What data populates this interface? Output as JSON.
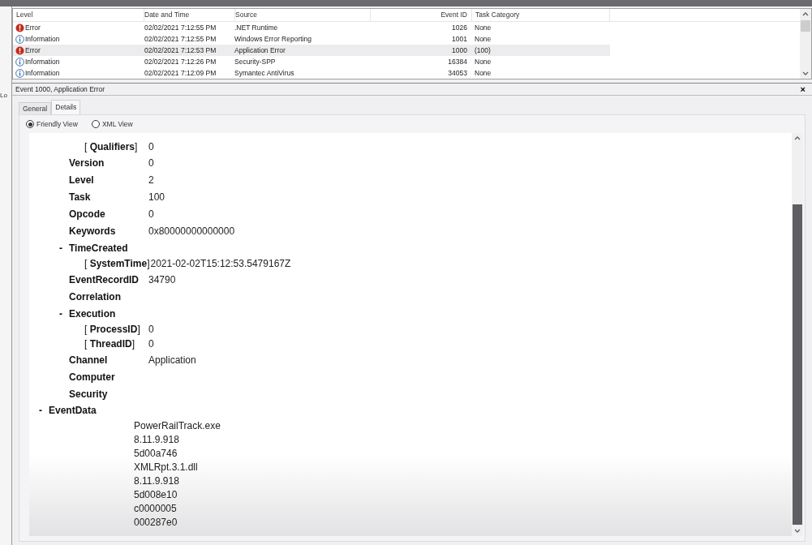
{
  "left_pane": {
    "text": "Lo"
  },
  "events": {
    "columns": [
      "Level",
      "Date and Time",
      "Source",
      "Event ID",
      "Task Category"
    ],
    "rows": [
      {
        "kind": "error",
        "level": "Error",
        "datetime": "02/02/2021 7:12:55 PM",
        "source": ".NET Runtime",
        "event_id": "1026",
        "task": "None",
        "selected": false
      },
      {
        "kind": "information",
        "level": "Information",
        "datetime": "02/02/2021 7:12:55 PM",
        "source": "Windows Error Reporting",
        "event_id": "1001",
        "task": "None",
        "selected": false
      },
      {
        "kind": "error",
        "level": "Error",
        "datetime": "02/02/2021 7:12:53 PM",
        "source": "Application Error",
        "event_id": "1000",
        "task": "(100)",
        "selected": true
      },
      {
        "kind": "information",
        "level": "Information",
        "datetime": "02/02/2021 7:12:26 PM",
        "source": "Security-SPP",
        "event_id": "16384",
        "task": "None",
        "selected": false
      },
      {
        "kind": "information",
        "level": "Information",
        "datetime": "02/02/2021 7:12:09 PM",
        "source": "Symantec AntiVirus",
        "event_id": "34053",
        "task": "None",
        "selected": false
      }
    ]
  },
  "details": {
    "title": "Event 1000, Application Error",
    "close": "×",
    "tabs": [
      {
        "label": "General",
        "selected": false
      },
      {
        "label": "Details",
        "selected": true
      }
    ],
    "views": [
      {
        "label": "Friendly View",
        "selected": true
      },
      {
        "label": "XML View",
        "selected": false
      }
    ],
    "system_fields": [
      {
        "children": [
          {
            "name": "[ **Qualifiers**]",
            "value": "0"
          }
        ]
      },
      {
        "name": "Version",
        "value": "0"
      },
      {
        "name": "Level",
        "value": "2"
      },
      {
        "name": "Task",
        "value": "100"
      },
      {
        "name": "Opcode",
        "value": "0"
      },
      {
        "name": "Keywords",
        "value": "0x80000000000000"
      },
      {
        "name": "TimeCreated",
        "toggle": "-",
        "children": [
          {
            "name": "[ **SystemTime**]",
            "value": "2021-02-02T15:12:53.5479167Z"
          }
        ]
      },
      {
        "name": "EventRecordID",
        "value": "34790"
      },
      {
        "name": "Correlation"
      },
      {
        "name": "Execution",
        "toggle": "-",
        "children": [
          {
            "name": "[ **ProcessID**]",
            "value": "0"
          },
          {
            "name": "[ **ThreadID**]",
            "value": "0"
          }
        ]
      },
      {
        "name": "Channel",
        "value": "Application"
      },
      {
        "name": "Computer"
      },
      {
        "name": "Security"
      }
    ],
    "event_data": {
      "name": "EventData",
      "toggle": "-",
      "values": [
        "PowerRailTrack.exe",
        "8.11.9.918",
        "5d00a746",
        "XMLRpt.3.1.dll",
        "8.11.9.918",
        "5d008e10",
        "c0000005",
        "000287e0"
      ]
    }
  }
}
